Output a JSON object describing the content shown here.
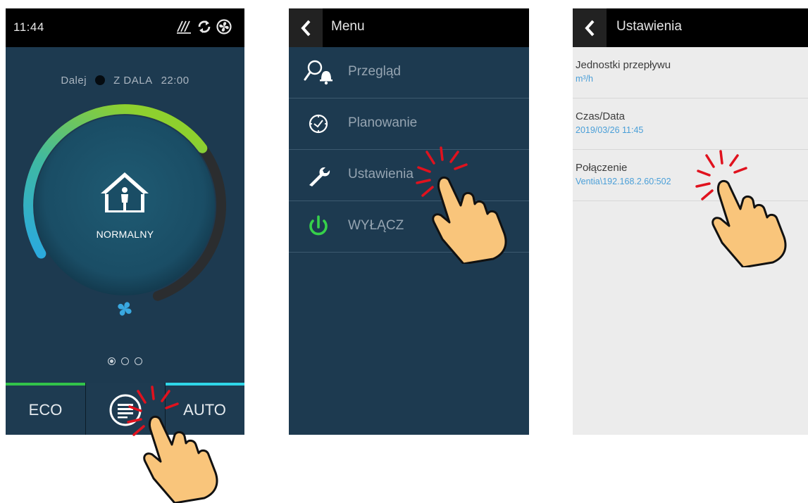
{
  "screen_main": {
    "time": "11:44",
    "next_label": "Dalej",
    "next_mode": "Z DALA",
    "next_time": "22:00",
    "mode_label": "NORMALNY",
    "level": 0.62,
    "pages": 3,
    "active_page": 0,
    "bottom": {
      "eco_label": "ECO",
      "auto_label": "AUTO"
    },
    "colors": {
      "background": "#1d3a50",
      "eco": "#32c34a",
      "auto": "#2fd6e8"
    },
    "icons": [
      "defrost-icon",
      "sync-icon",
      "fan-icon",
      "home-person-icon",
      "menu-icon"
    ]
  },
  "screen_menu": {
    "title": "Menu",
    "items": [
      {
        "label": "Przegląd",
        "icon": "search-bell-icon"
      },
      {
        "label": "Planowanie",
        "icon": "clock-icon"
      },
      {
        "label": "Ustawienia",
        "icon": "wrench-icon"
      },
      {
        "label": "WYŁĄCZ",
        "icon": "power-icon"
      }
    ]
  },
  "screen_settings": {
    "title": "Ustawienia",
    "items": [
      {
        "title": "Jednostki przepływu",
        "value": "m³/h"
      },
      {
        "title": "Czas/Data",
        "value": "2019/03/26 11:45"
      },
      {
        "title": "Połączenie",
        "value": "Ventia\\192.168.2.60:502"
      }
    ]
  }
}
